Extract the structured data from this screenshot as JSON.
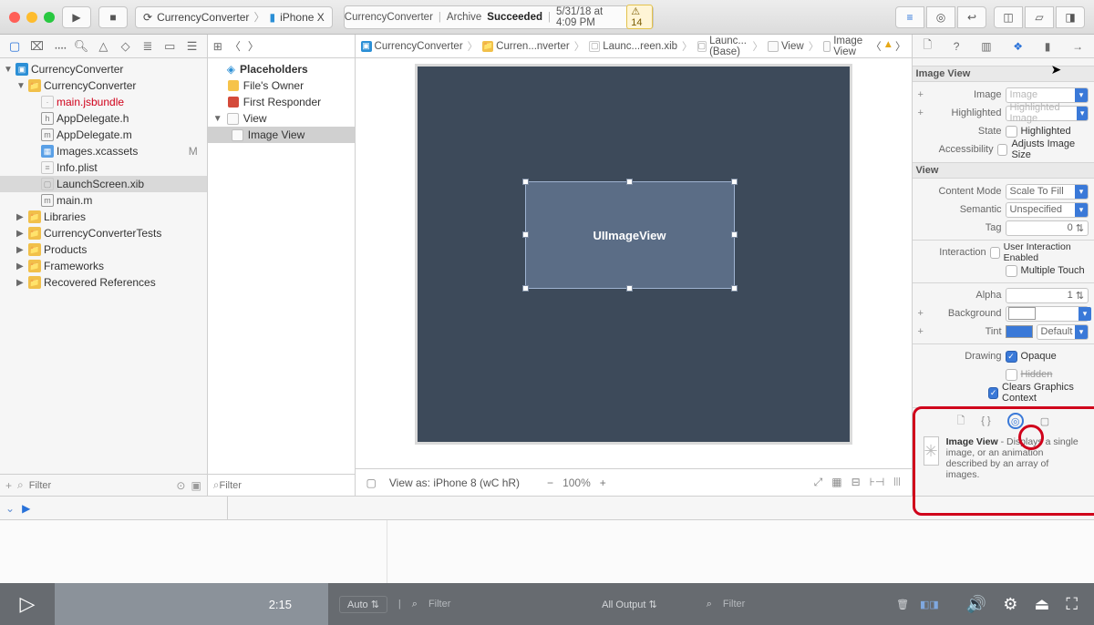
{
  "toolbar": {
    "scheme_app": "CurrencyConverter",
    "scheme_device": "iPhone X",
    "status_app": "CurrencyConverter",
    "status_action": "Archive",
    "status_result": "Succeeded",
    "status_time": "5/31/18 at 4:09 PM",
    "warnings": "14"
  },
  "navigator": {
    "root": "CurrencyConverter",
    "group": "CurrencyConverter",
    "files": {
      "mainjs": "main.jsbundle",
      "appdel_h": "AppDelegate.h",
      "appdel_m": "AppDelegate.m",
      "images": "Images.xcassets",
      "modified": "M",
      "info": "Info.plist",
      "launch": "LaunchScreen.xib",
      "mainm": "main.m"
    },
    "folders": [
      "Libraries",
      "CurrencyConverterTests",
      "Products",
      "Frameworks",
      "Recovered References"
    ],
    "filter_placeholder": "Filter"
  },
  "outline": {
    "placeholders": "Placeholders",
    "files_owner": "File's Owner",
    "first_responder": "First Responder",
    "view": "View",
    "image_view": "Image View",
    "filter_placeholder": "Filter"
  },
  "jumpbar": {
    "segments": [
      "CurrencyConverter",
      "Curren...nverter",
      "Launc...reen.xib",
      "Launc...(Base)",
      "View",
      "Image View"
    ]
  },
  "canvas": {
    "selected_label": "UIImageView",
    "viewas": "View as: iPhone 8 (wC hR)",
    "zoom": "100%"
  },
  "inspector": {
    "section1": "Image View",
    "image_label": "Image",
    "image_placeholder": "Image",
    "highlighted_label": "Highlighted",
    "highlighted_placeholder": "Highlighted Image",
    "state_label": "State",
    "state_check": "Highlighted",
    "accessibility_label": "Accessibility",
    "accessibility_check": "Adjusts Image Size",
    "section2": "View",
    "content_mode_label": "Content Mode",
    "content_mode_value": "Scale To Fill",
    "semantic_label": "Semantic",
    "semantic_value": "Unspecified",
    "tag_label": "Tag",
    "tag_value": "0",
    "interaction_label": "Interaction",
    "interaction1": "User Interaction Enabled",
    "interaction2": "Multiple Touch",
    "alpha_label": "Alpha",
    "alpha_value": "1",
    "background_label": "Background",
    "tint_label": "Tint",
    "tint_value": "Default",
    "drawing_label": "Drawing",
    "drawing1": "Opaque",
    "drawing2": "Hidden",
    "drawing3": "Clears Graphics Context",
    "lib_title": "Image View",
    "lib_desc": " - Displays a single image, or an animation described by an array of images."
  },
  "debug": {
    "auto": "Auto",
    "filter": "Filter",
    "alloutput": "All Output",
    "filter2": "Filter"
  },
  "video": {
    "time": "2:15"
  }
}
